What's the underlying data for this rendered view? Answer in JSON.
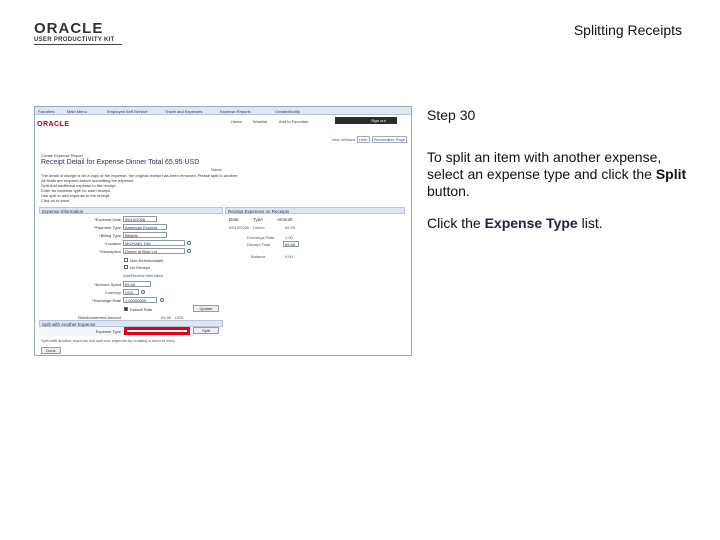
{
  "header": {
    "logo_brand": "ORACLE",
    "logo_product": "USER PRODUCTIVITY KIT",
    "slide_title": "Splitting Receipts"
  },
  "screenshot": {
    "logo": "ORACLE",
    "topnav": [
      "Favorites",
      "Main Menu",
      "Employee Self-Service",
      "Travel and Expenses",
      "Expense Reports",
      "Create/Modify"
    ],
    "subnav": [
      "Home",
      "Worklist",
      "Add to Favorites",
      "Sign out"
    ],
    "right_links": [
      "New Window",
      "Help",
      "Personalize Page"
    ],
    "breadcrumb": "Create Expense Report",
    "receipt_title": "Receipt Detail for Expense Dinner",
    "receipt_total": "Total 65.95 USD",
    "name_label": "Name",
    "instructions": [
      "The detail of charge is for a copy of the expense, the original receipt has been removed. Please split to another.",
      "All fields are required before submitting the expense.",
      "Split Add additional expense to the receipt.",
      "Enter an expense type for each receipt.",
      "Use split to add expense to the receipt.",
      "Click ok to save."
    ],
    "sections": {
      "expense_info": "Expense Information",
      "receipt_expenses": "Receipt Expenses on Receipts",
      "split_header": "Split with Another Expense"
    },
    "form": {
      "expense_date_label": "*Expense Date",
      "expense_date_value": "09/15/2008",
      "payment_type_label": "*Payment Type",
      "payment_type_value": "American Express",
      "billing_type_label": "*Billing Type",
      "billing_type_value": "Billable",
      "location_label": "*Location",
      "location_value": "MICHAEL DIN",
      "description_label": "*Description",
      "description_value": "Dinner at Blue Lot",
      "checkbox_non_reimb": "Non-Reimbursable",
      "checkbox_no_receipt": "No Receipt",
      "attendees_link": "Add/Review Attendees",
      "amount_spent_label": "*Amount Spent",
      "amount_spent_value": "65.95",
      "currency_label": "Currency",
      "currency_value": "USD",
      "exchange_rate_label": "*Exchange Rate",
      "exchange_rate_value": "1.00000000",
      "default_rate_label": "Default Rate",
      "update_button": "Update",
      "reimb_amount_label": "Reimbursement Amount",
      "reimb_amount_value": "65.95",
      "reimb_currency": "USD",
      "expense_type_label": "Expense Type",
      "split_button": "Split",
      "done_button": "Done",
      "note": "Split with another expense will split one expense by creating a second entry."
    },
    "receipt_table": {
      "headers": [
        "Date",
        "Type",
        "Amount"
      ],
      "rows": [
        [
          "09/15/2008",
          "Dinner",
          "65.95"
        ],
        [
          "",
          "Exchange Rate",
          "1.00"
        ],
        [
          "",
          "Receipt Total",
          "65.95"
        ],
        [
          "",
          "Balance",
          "0.00"
        ]
      ]
    }
  },
  "step": {
    "title": "Step 30",
    "instruction_pre": "To split an item with another expense, select an expense type and click the ",
    "instruction_bold": "Split",
    "instruction_post": " button.",
    "action_pre": "Click the ",
    "action_term": "Expense Type",
    "action_post": " list."
  }
}
